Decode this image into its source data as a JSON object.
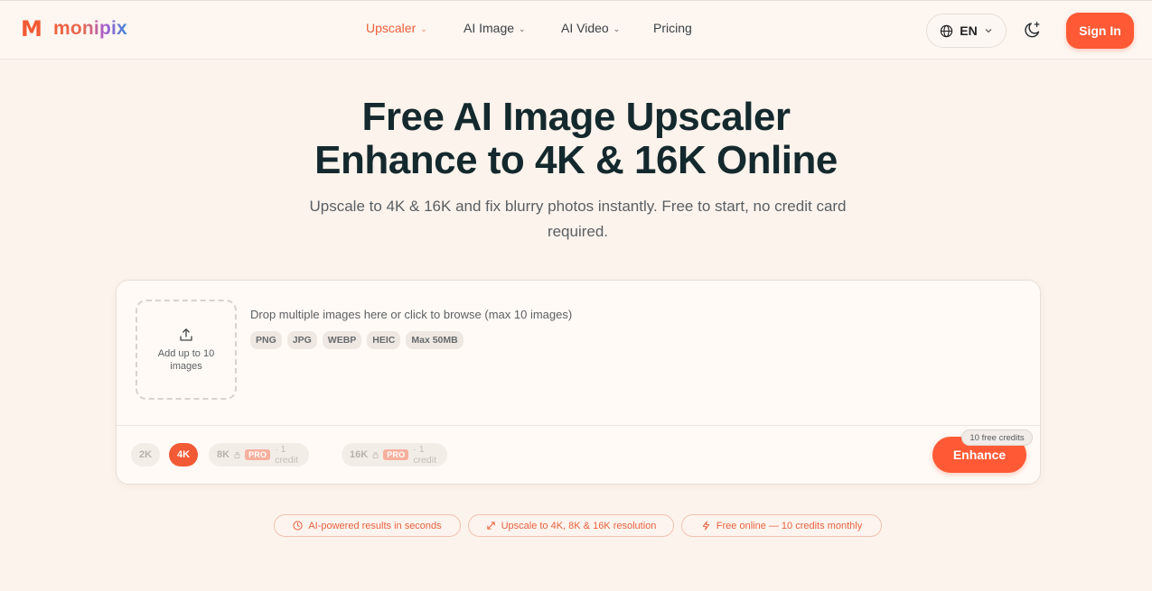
{
  "brand": {
    "logo_mark": "M",
    "name": "monipix",
    "accent": "#ff5a35"
  },
  "nav": {
    "items": [
      {
        "label": "Upscaler",
        "dropdown": true,
        "active": true
      },
      {
        "label": "AI Image",
        "dropdown": true,
        "active": false
      },
      {
        "label": "AI Video",
        "dropdown": true,
        "active": false
      },
      {
        "label": "Pricing",
        "dropdown": false,
        "active": false
      }
    ],
    "language": "EN",
    "theme_icon": "moon-sparkle-icon",
    "signin_label": "Sign In"
  },
  "hero": {
    "title_line1": "Free AI Image Upscaler",
    "title_line2": "Enhance to 4K & 16K Online",
    "subtitle": "Upscale to 4K & 16K and fix blurry photos instantly. Free to start, no credit card required."
  },
  "upload": {
    "dropzone_label": "Add up to 10 images",
    "hint": "Drop multiple images here or click to browse (max 10 images)",
    "formats": [
      "PNG",
      "JPG",
      "WEBP",
      "HEIC",
      "Max 50MB"
    ]
  },
  "resolutions": [
    {
      "label": "2K",
      "selected": false,
      "locked": false
    },
    {
      "label": "4K",
      "selected": true,
      "locked": false
    },
    {
      "label": "8K",
      "selected": false,
      "locked": true,
      "badge": "PRO",
      "cost": "· 1 credit"
    },
    {
      "label": "16K",
      "selected": false,
      "locked": true,
      "badge": "PRO",
      "cost": "· 1 credit"
    }
  ],
  "enhance": {
    "label": "Enhance",
    "credits_badge": "10 free credits"
  },
  "features": [
    {
      "icon": "clock-icon",
      "label": "AI-powered results in seconds"
    },
    {
      "icon": "expand-icon",
      "label": "Upscale to 4K, 8K & 16K resolution"
    },
    {
      "icon": "bolt-icon",
      "label": "Free online — 10 credits monthly"
    }
  ]
}
